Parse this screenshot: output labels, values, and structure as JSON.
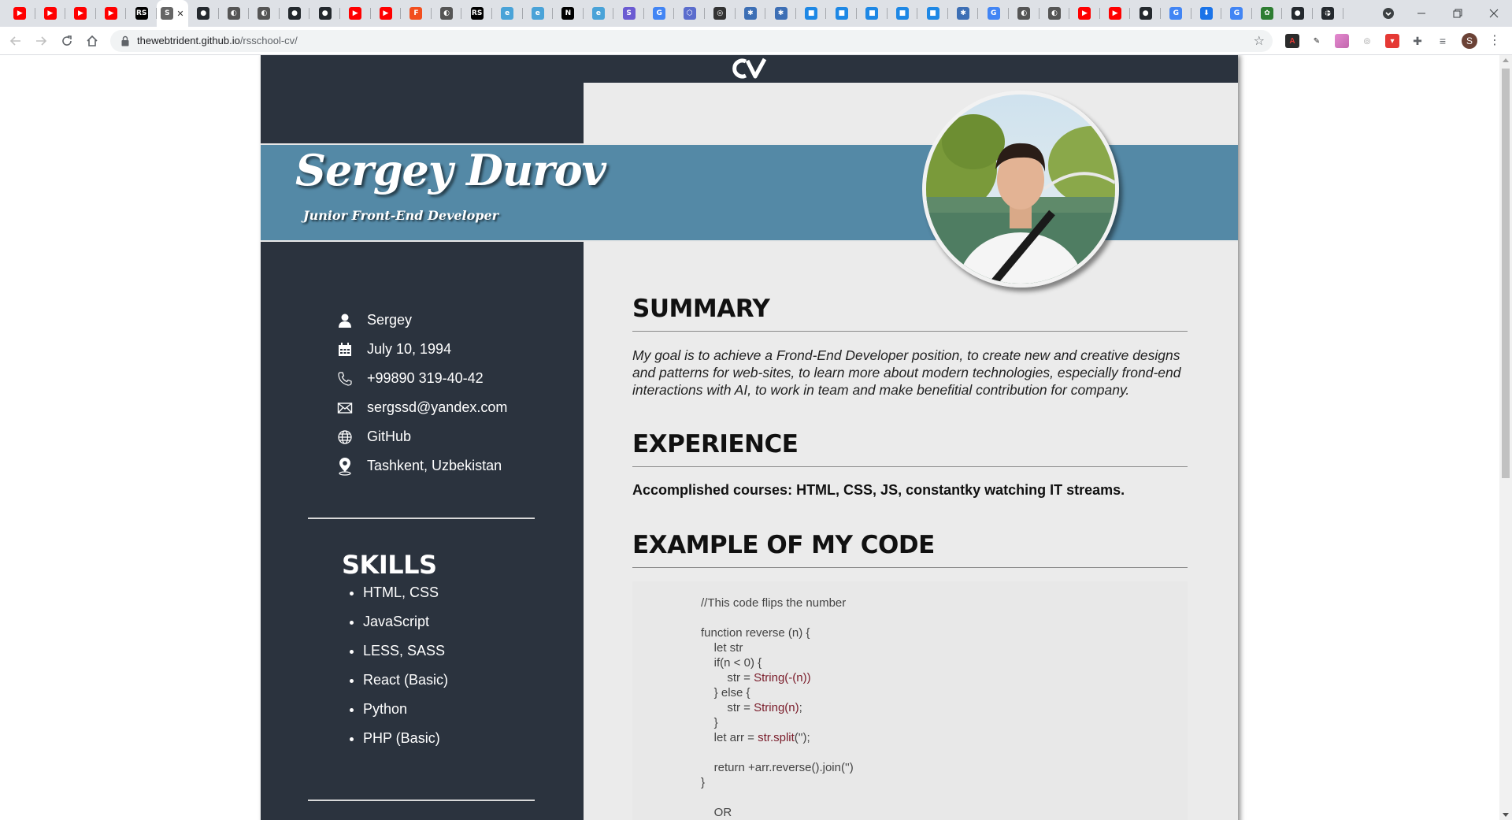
{
  "browser": {
    "tabs": [
      {
        "icon": "youtube-icon",
        "color": "#ff0000",
        "glyph": "▶"
      },
      {
        "icon": "youtube-icon",
        "color": "#ff0000",
        "glyph": "▶"
      },
      {
        "icon": "youtube-icon",
        "color": "#ff0000",
        "glyph": "▶"
      },
      {
        "icon": "youtube-icon",
        "color": "#ff0000",
        "glyph": "▶"
      },
      {
        "icon": "rs-school-icon",
        "color": "#000000",
        "glyph": "RS"
      },
      {
        "icon": "page-icon",
        "color": "#666666",
        "glyph": "S",
        "active": true
      },
      {
        "icon": "github-icon",
        "color": "#24292e",
        "glyph": "●"
      },
      {
        "icon": "generic-site-icon",
        "color": "#555555",
        "glyph": "◐"
      },
      {
        "icon": "generic-site-icon",
        "color": "#555555",
        "glyph": "◐"
      },
      {
        "icon": "github-icon",
        "color": "#24292e",
        "glyph": "●"
      },
      {
        "icon": "github-icon",
        "color": "#24292e",
        "glyph": "●"
      },
      {
        "icon": "youtube-icon",
        "color": "#ff0000",
        "glyph": "▶"
      },
      {
        "icon": "youtube-icon",
        "color": "#ff0000",
        "glyph": "▶"
      },
      {
        "icon": "figma-icon",
        "color": "#f24e1e",
        "glyph": "F"
      },
      {
        "icon": "generic-site-icon",
        "color": "#555555",
        "glyph": "◐"
      },
      {
        "icon": "rs-school-icon",
        "color": "#000000",
        "glyph": "RS"
      },
      {
        "icon": "edge-icon",
        "color": "#4aa3d8",
        "glyph": "e"
      },
      {
        "icon": "edge-icon",
        "color": "#4aa3d8",
        "glyph": "e"
      },
      {
        "icon": "notion-icon",
        "color": "#000000",
        "glyph": "N"
      },
      {
        "icon": "edge-icon",
        "color": "#4aa3d8",
        "glyph": "e"
      },
      {
        "icon": "stackblitz-icon",
        "color": "#6b5bd2",
        "glyph": "S"
      },
      {
        "icon": "google-icon",
        "color": "#4285f4",
        "glyph": "G"
      },
      {
        "icon": "hexagon-icon",
        "color": "#5b6dcd",
        "glyph": "⬡"
      },
      {
        "icon": "chrome-icon",
        "color": "#333333",
        "glyph": "◎"
      },
      {
        "icon": "react-icon",
        "color": "#3d6fb5",
        "glyph": "✱"
      },
      {
        "icon": "react-icon",
        "color": "#3d6fb5",
        "glyph": "✱"
      },
      {
        "icon": "multicolor-icon",
        "color": "#1e88e5",
        "glyph": "■"
      },
      {
        "icon": "multicolor-icon",
        "color": "#1e88e5",
        "glyph": "■"
      },
      {
        "icon": "multicolor-icon",
        "color": "#1e88e5",
        "glyph": "■"
      },
      {
        "icon": "multicolor-icon",
        "color": "#1e88e5",
        "glyph": "■"
      },
      {
        "icon": "multicolor-icon",
        "color": "#1e88e5",
        "glyph": "■"
      },
      {
        "icon": "react-icon",
        "color": "#3d6fb5",
        "glyph": "✱"
      },
      {
        "icon": "google-icon",
        "color": "#4285f4",
        "glyph": "G"
      },
      {
        "icon": "generic-site-icon",
        "color": "#555555",
        "glyph": "◐"
      },
      {
        "icon": "generic-site-icon",
        "color": "#555555",
        "glyph": "◐"
      },
      {
        "icon": "youtube-icon",
        "color": "#ff0000",
        "glyph": "▶"
      },
      {
        "icon": "youtube-icon",
        "color": "#ff0000",
        "glyph": "▶"
      },
      {
        "icon": "github-icon",
        "color": "#24292e",
        "glyph": "●"
      },
      {
        "icon": "google-icon",
        "color": "#4285f4",
        "glyph": "G"
      },
      {
        "icon": "download-icon",
        "color": "#1a73e8",
        "glyph": "⬇"
      },
      {
        "icon": "google-icon",
        "color": "#4285f4",
        "glyph": "G"
      },
      {
        "icon": "plant-icon",
        "color": "#2e7d32",
        "glyph": "✿"
      },
      {
        "icon": "github-icon",
        "color": "#24292e",
        "glyph": "●"
      },
      {
        "icon": "github-icon",
        "color": "#24292e",
        "glyph": "●"
      }
    ],
    "url_host": "thewebtrident.github.io",
    "url_path": "/rsschool-cv/",
    "new_tab_label": "+",
    "profile_initial": "S"
  },
  "cv": {
    "logo": "CV",
    "name": "Sergey Durov",
    "job_title": "Junior Front-End Developer",
    "contacts": [
      {
        "icon": "person-icon",
        "text": "Sergey"
      },
      {
        "icon": "calendar-icon",
        "text": "July 10, 1994"
      },
      {
        "icon": "phone-icon",
        "text": "+99890 319-40-42"
      },
      {
        "icon": "mail-icon",
        "text": "sergssd@yandex.com"
      },
      {
        "icon": "globe-icon",
        "text": "GitHub"
      },
      {
        "icon": "location-icon",
        "text": "Tashkent, Uzbekistan"
      }
    ],
    "skills_title": "SKILLS",
    "skills": [
      "HTML, CSS",
      "JavaScript",
      "LESS, SASS",
      "React (Basic)",
      "Python",
      "PHP (Basic)"
    ],
    "summary_title": "SUMMARY",
    "summary_text": "My goal is to achieve a Frond-End Developer position, to create new and creative designs and patterns for web-sites, to learn more about modern technologies, especially frond-end interactions with AI, to work in team and make benefitial contribution for company.",
    "experience_title": "EXPERIENCE",
    "experience_text": "Accomplished courses: HTML, CSS, JS, constantky watching IT streams.",
    "code_title": "EXAMPLE OF MY CODE",
    "code_lines": [
      "//This code flips the number",
      "",
      "function reverse (n) {",
      "    let str",
      "    if(n < 0) {",
      "        str = String(-(n))",
      "    } else {",
      "        str = String(n);",
      "    }",
      "    let arr = str.split('');",
      "",
      "    return +arr.reverse().join('')",
      "}",
      "",
      "    OR"
    ]
  }
}
